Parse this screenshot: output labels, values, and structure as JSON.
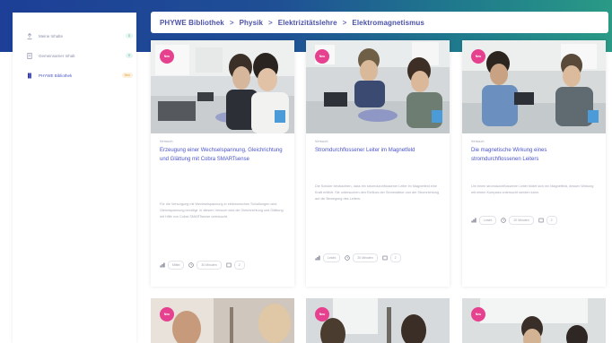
{
  "sidebar": {
    "items": [
      {
        "label": "Meine Inhalte",
        "badge": "0"
      },
      {
        "label": "Gemeinsamer Inhalt",
        "badge": "0"
      },
      {
        "label": "PHYWE Bibliothek",
        "badge": "Neu"
      }
    ]
  },
  "breadcrumb": [
    "PHYWE Bibliothek",
    "Physik",
    "Elektrizitätslehre",
    "Elektromagnetismus"
  ],
  "breadcrumb_separator": ">",
  "cards": [
    {
      "badge": "Neu",
      "category": "Versuch",
      "title": "Erzeugung einer Wechselspannung, Gleichrichtung und Glättung mit Cobra SMARTsense",
      "description": "Für die Versorgung mit Wechselspannung in elektronischen Schaltungen wird Gleichspannung benötigt. In diesem Versuch wird die Gleichrichtung und Glättung mit Hilfe von Cobra SMARTsense untersucht.",
      "level": "Mittel",
      "duration": "30 Minuten",
      "pages": "2"
    },
    {
      "badge": "Neu",
      "category": "Versuch",
      "title": "Stromdurchflossener Leiter im Magnetfeld",
      "description": "Die Schüler beobachten, dass ein stromdurchflossener Leiter im Magnetfeld eine Kraft erfährt. Sie untersuchen den Einfluss der Stromstärke und der Stromrichtung auf die Bewegung des Leiters.",
      "level": "Leicht",
      "duration": "20 Minuten",
      "pages": "2"
    },
    {
      "badge": "Neu",
      "category": "Versuch",
      "title": "Die magnetische Wirkung eines stromdurchflossenen Leiters",
      "description": "Um einen stromdurchflossenen Leiter bildet sich ein Magnetfeld, dessen Wirkung mit einem Kompass untersucht werden kann.",
      "level": "Leicht",
      "duration": "20 Minuten",
      "pages": "2"
    }
  ],
  "second_row": [
    {
      "badge": "Neu"
    },
    {
      "badge": "Neu"
    },
    {
      "badge": "Neu"
    }
  ],
  "colors": {
    "accent": "#4b54c8",
    "badge": "#e5418e",
    "band_start": "#1d3f97",
    "band_end": "#2a9a86"
  }
}
